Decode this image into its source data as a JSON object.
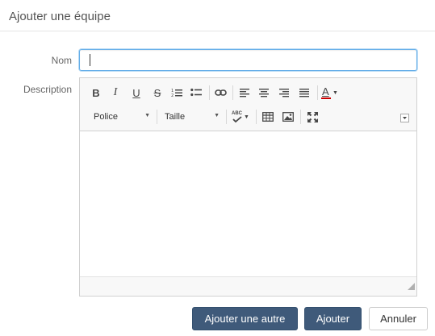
{
  "dialog": {
    "title": "Ajouter une équipe"
  },
  "form": {
    "name_label": "Nom",
    "name_value": "",
    "description_label": "Description"
  },
  "editor": {
    "font_combo": "Police",
    "size_combo": "Taille",
    "content": "",
    "toolbar_row1": [
      "bold-icon",
      "italic-icon",
      "underline-icon",
      "strikethrough-icon",
      "numbered-list-icon",
      "bulleted-list-icon",
      "link-icon",
      "align-left-icon",
      "align-center-icon",
      "align-right-icon",
      "align-justify-icon",
      "text-color-icon"
    ],
    "toolbar_row2": [
      "spellcheck-icon",
      "table-icon",
      "image-icon",
      "maximize-icon",
      "collapse-toolbar-icon"
    ],
    "text_color_letter": "A",
    "spellcheck_text": "ABC"
  },
  "actions": {
    "add_another": "Ajouter une autre",
    "add": "Ajouter",
    "cancel": "Annuler"
  },
  "colors": {
    "primary": "#3f5a7a",
    "focus": "#66afe9",
    "text_color_bar": "#cc0000"
  }
}
